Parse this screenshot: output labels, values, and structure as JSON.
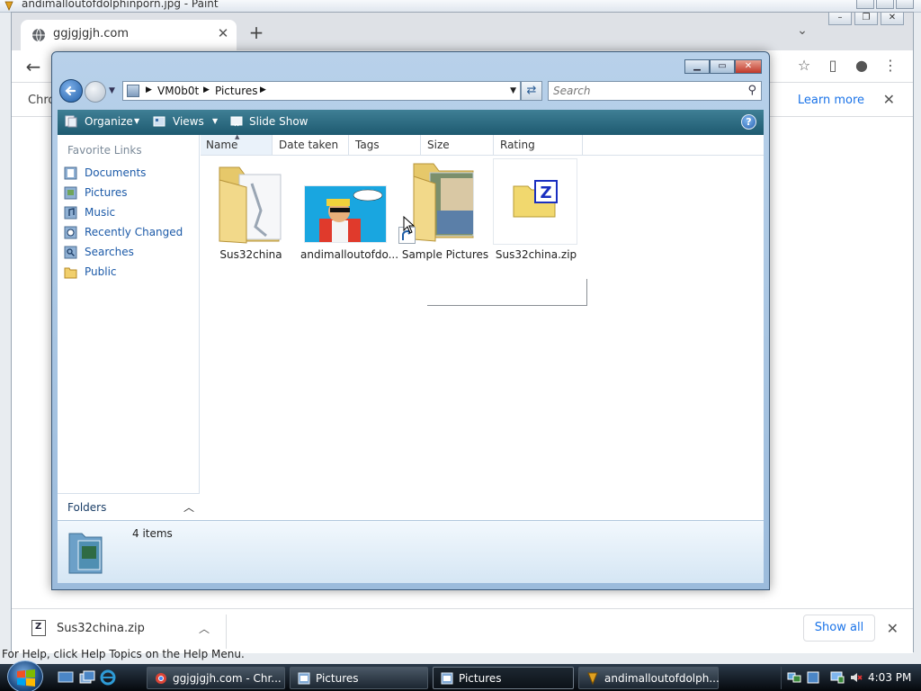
{
  "paint": {
    "title": "andimalloutofdolphinporn.jpg - Paint"
  },
  "chrome": {
    "tab_title": "ggjgjgjh.com",
    "info_prefix": "Chro",
    "learn_more": "Learn more",
    "download_name": "Sus32china.zip",
    "show_all": "Show all"
  },
  "paint_status": "For Help, click Help Topics on the Help Menu.",
  "explorer": {
    "breadcrumb": [
      "VM0b0t",
      "Pictures"
    ],
    "search_placeholder": "Search",
    "toolbar": {
      "organize": "Organize",
      "views": "Views",
      "slideshow": "Slide Show"
    },
    "favorite_links_title": "Favorite Links",
    "favorite_links": [
      {
        "label": "Documents",
        "icon": "documents-icon"
      },
      {
        "label": "Pictures",
        "icon": "pictures-icon"
      },
      {
        "label": "Music",
        "icon": "music-icon"
      },
      {
        "label": "Recently Changed",
        "icon": "recently-changed-icon"
      },
      {
        "label": "Searches",
        "icon": "searches-icon"
      },
      {
        "label": "Public",
        "icon": "public-folder-icon"
      }
    ],
    "folders_label": "Folders",
    "columns": [
      "Name",
      "Date taken",
      "Tags",
      "Size",
      "Rating"
    ],
    "items": [
      {
        "name": "Sus32china",
        "type": "folder"
      },
      {
        "name": "andimalloutofdo...",
        "type": "image"
      },
      {
        "name": "Sample Pictures",
        "type": "folder-shortcut"
      },
      {
        "name": "Sus32china.zip",
        "type": "zip"
      }
    ],
    "item_count": "4 items"
  },
  "taskbar": {
    "tasks": [
      {
        "label": "ggjgjgjh.com - Chr...",
        "icon": "chrome-icon",
        "active": false
      },
      {
        "label": "Pictures",
        "icon": "explorer-icon",
        "active": false
      },
      {
        "label": "Pictures",
        "icon": "explorer-icon",
        "active": true
      },
      {
        "label": "andimalloutofdolph...",
        "icon": "paint-icon",
        "active": false
      }
    ],
    "clock": "4:03 PM"
  }
}
